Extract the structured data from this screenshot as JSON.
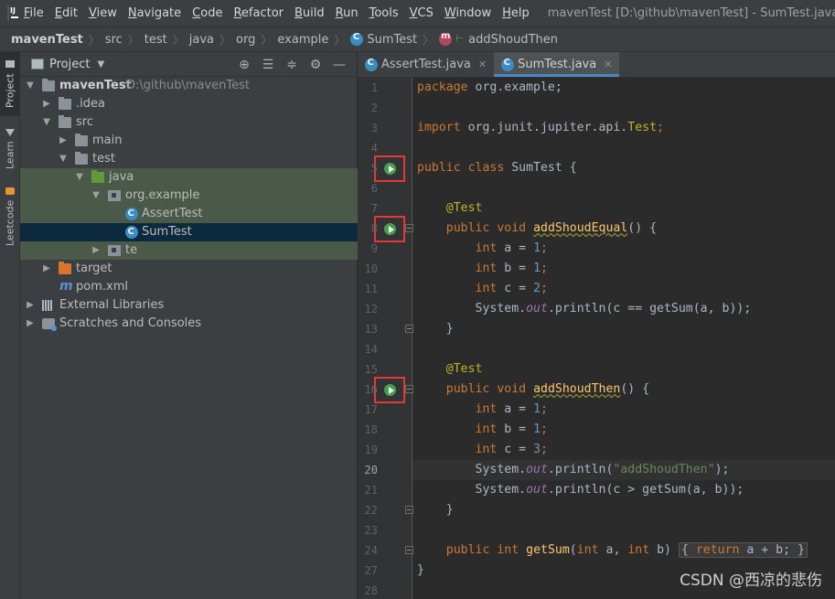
{
  "menu": {
    "items": [
      "File",
      "Edit",
      "View",
      "Navigate",
      "Code",
      "Refactor",
      "Build",
      "Run",
      "Tools",
      "VCS",
      "Window",
      "Help"
    ],
    "window_title": "mavenTest [D:\\github\\mavenTest] - SumTest.java"
  },
  "breadcrumb": {
    "items": [
      "mavenTest",
      "src",
      "test",
      "java",
      "org",
      "example",
      "SumTest",
      "addShoudThen"
    ]
  },
  "left_strip": {
    "tabs": [
      "Project",
      "Learn",
      "Leetcode"
    ]
  },
  "project_panel": {
    "title": "Project",
    "tree": {
      "root_name": "mavenTest",
      "root_path": "D:\\github\\mavenTest",
      "idea": ".idea",
      "src": "src",
      "main": "main",
      "test": "test",
      "java": "java",
      "org_example": "org.example",
      "assert_test": "AssertTest",
      "sum_test": "SumTest",
      "te": "te",
      "target": "target",
      "pom": "pom.xml",
      "ext_libs": "External Libraries",
      "scratches": "Scratches and Consoles"
    }
  },
  "editor": {
    "tabs": [
      {
        "label": "AssertTest.java",
        "active": false
      },
      {
        "label": "SumTest.java",
        "active": true
      }
    ],
    "line_numbers": [
      "1",
      "2",
      "3",
      "4",
      "5",
      "6",
      "7",
      "8",
      "9",
      "10",
      "11",
      "12",
      "13",
      "14",
      "15",
      "16",
      "17",
      "18",
      "19",
      "20",
      "21",
      "22",
      "23",
      "24",
      "27",
      "28"
    ],
    "current_line": "20",
    "code": {
      "package_kw": "package",
      "package_name": " org.example;",
      "import_kw": "import",
      "import_path": " org.junit.jupiter.api.",
      "import_cls": "Test",
      "import_end": ";",
      "public": "public",
      "class": "class",
      "class_name": " SumTest {",
      "ann_test": "@Test",
      "void": "void",
      "m1": "addShoudEqual",
      "m2": "addShoudThen",
      "m3": "getSum",
      "sig_end": "() {",
      "int": "int",
      "a_eq": " a = ",
      "b_eq": " b = ",
      "c_eq": " c = ",
      "one": "1",
      "two": "2",
      "three": "3",
      "semi": ";",
      "sys": "System.",
      "out": "out",
      "println": ".println(",
      "p1_arg": "c == getSum(a, b));",
      "p2_str": "\"addShoudThen\"",
      "p2_end": ");",
      "p3_arg": "c > getSum(a, b));",
      "close_brace": "}",
      "gs_params_1": "(",
      "gs_a": " a, ",
      "gs_b": " b)",
      "gs_body_open": "{ ",
      "return": "return",
      "gs_body": " a + b; ",
      "gs_body_close": "}"
    }
  },
  "watermark": "CSDN @西凉的悲伤"
}
